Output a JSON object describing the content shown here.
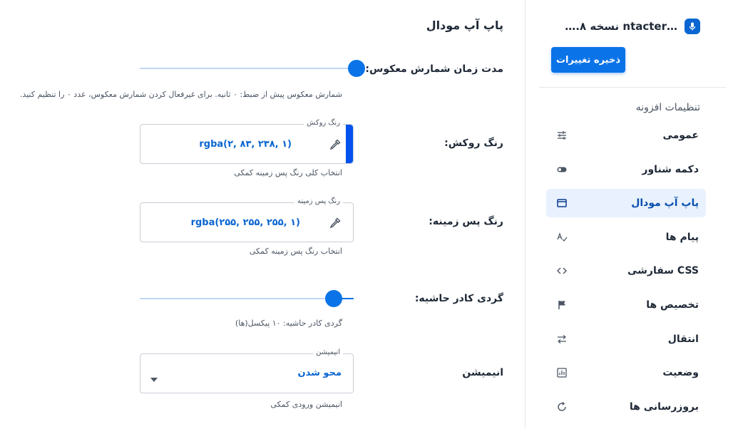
{
  "sidebar": {
    "brand_title": "…ntacter نسخه ۸.…",
    "save_label": "ذخیره تغییرات",
    "section_heading": "تنظیمات افزونه",
    "items": [
      {
        "label": "عمومی",
        "icon": "sliders-icon",
        "active": false
      },
      {
        "label": "دکمه شناور",
        "icon": "toggle-icon",
        "active": false
      },
      {
        "label": "پاپ آپ مودال",
        "icon": "window-icon",
        "active": true
      },
      {
        "label": "پیام ها",
        "icon": "text-check-icon",
        "active": false
      },
      {
        "label": "CSS سفارشی",
        "icon": "code-icon",
        "active": false
      },
      {
        "label": "تخصیص ها",
        "icon": "flag-icon",
        "active": false
      },
      {
        "label": "انتقال",
        "icon": "transfer-icon",
        "active": false
      },
      {
        "label": "وضعیت",
        "icon": "bar-chart-icon",
        "active": false
      },
      {
        "label": "بروزرسانی ها",
        "icon": "refresh-icon",
        "active": false
      }
    ]
  },
  "main": {
    "title": "پاپ آپ مودال",
    "countdown": {
      "label": "مدت زمان شمارش معکوس:",
      "value_fraction": 0.0,
      "help": "شمارش معکوس پیش از ضبط: ۰ ثانیه. برای غیرفعال کردن شمارش معکوس، عدد ۰ را تنظیم کنید."
    },
    "accent_color": {
      "label": "رنگ روکش:",
      "legend": "رنگ روکش",
      "value": "rgba(۲, ۸۳, ۲۳۸, ۱)",
      "swatch": "#0253ee",
      "help": "انتخاب کلی رنگ پس زمینه کمکی"
    },
    "background_color": {
      "label": "رنگ پس زمینه:",
      "legend": "رنگ پس زمینه",
      "value": "rgba(۲۵۵, ۲۵۵, ۲۵۵, ۱)",
      "swatch": "#ffffff",
      "help": "انتخاب رنگ پس زمینه کمکی"
    },
    "border_radius": {
      "label": "گردی کادر حاشیه:",
      "value_fraction": 0.1,
      "help": "گردی کادر حاشیه: ۱۰ پیکسل(ها)"
    },
    "animation": {
      "label": "انیمیشن",
      "legend": "انیمیشن",
      "value": "محو شدن",
      "help": "انیمیشن ورودی کمکی"
    }
  },
  "colors": {
    "accent": "#0a73e8",
    "active_bg": "#e8f1fd"
  }
}
